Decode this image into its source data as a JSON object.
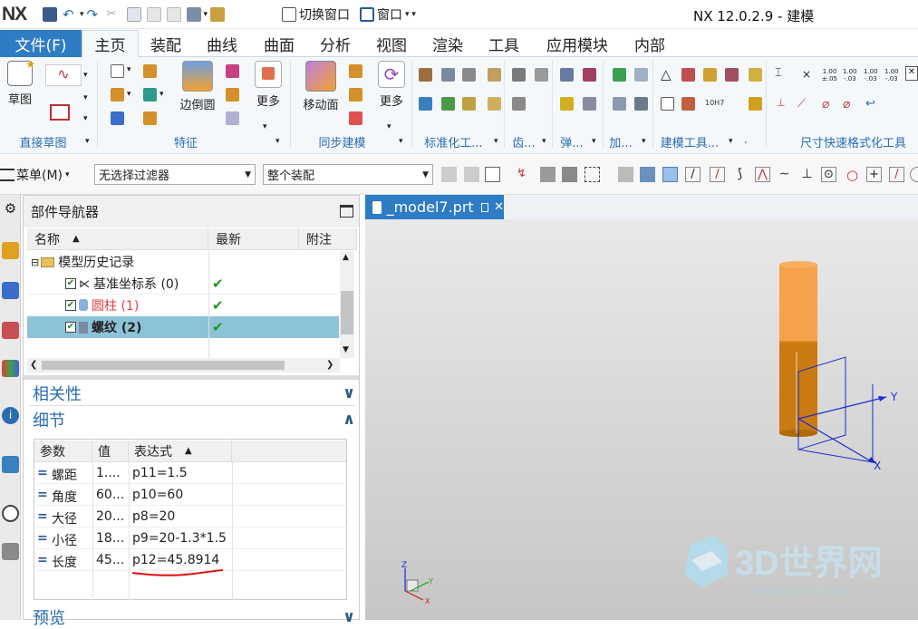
{
  "title_bar": {
    "logo": "NX",
    "switch_window": "切换窗口",
    "window_menu": "窗口",
    "app_title": "NX 12.0.2.9 - 建模"
  },
  "tabs": {
    "file": "文件(F)",
    "items": [
      "主页",
      "装配",
      "曲线",
      "曲面",
      "分析",
      "视图",
      "渲染",
      "工具",
      "应用模块",
      "内部"
    ]
  },
  "ribbon": {
    "sketch": "草图",
    "edge_blend": "边倒圆",
    "more1": "更多",
    "move_face": "移动面",
    "more2": "更多",
    "groups": [
      "直接草图",
      "特征",
      "同步建模",
      "标准化工...",
      "齿...",
      "弹...",
      "加...",
      "建模工具...",
      ".",
      "尺寸快速格式化工具"
    ]
  },
  "toolbar2": {
    "menu": "菜单(M)",
    "filter": "无选择过滤器",
    "scope": "整个装配"
  },
  "navigator": {
    "title": "部件导航器",
    "columns": [
      "名称",
      "最新",
      "附注"
    ],
    "root": "模型历史记录",
    "items": [
      {
        "label": "基准坐标系 (0)"
      },
      {
        "label": "圆柱 (1)"
      },
      {
        "label": "螺纹 (2)"
      }
    ]
  },
  "sections": {
    "dependencies": "相关性",
    "details": "细节",
    "preview": "预览"
  },
  "details": {
    "columns": [
      "参数",
      "值",
      "表达式"
    ],
    "rows": [
      {
        "eq": "=",
        "param": "螺距",
        "value": "1....",
        "expr": "p11=1.5"
      },
      {
        "eq": "=",
        "param": "角度",
        "value": "60...",
        "expr": "p10=60"
      },
      {
        "eq": "=",
        "param": "大径",
        "value": "20...",
        "expr": "p8=20"
      },
      {
        "eq": "=",
        "param": "小径",
        "value": "18...",
        "expr": "p9=20-1.3*1.5"
      },
      {
        "eq": "=",
        "param": "长度",
        "value": "45...",
        "expr": "p12=45.8914"
      }
    ]
  },
  "viewport": {
    "tab": "_model7.prt",
    "axis_x": "X",
    "axis_y": "Y",
    "watermark": "3D世界网",
    "watermark_url": "WWW.3DSJW.COM"
  },
  "colors": {
    "accent": "#2e7cc4",
    "selected_row": "#8cc3d8",
    "cylinder": "#c97a10",
    "cylinder_top": "#f5a24a",
    "axes": "#1a2ad0"
  }
}
